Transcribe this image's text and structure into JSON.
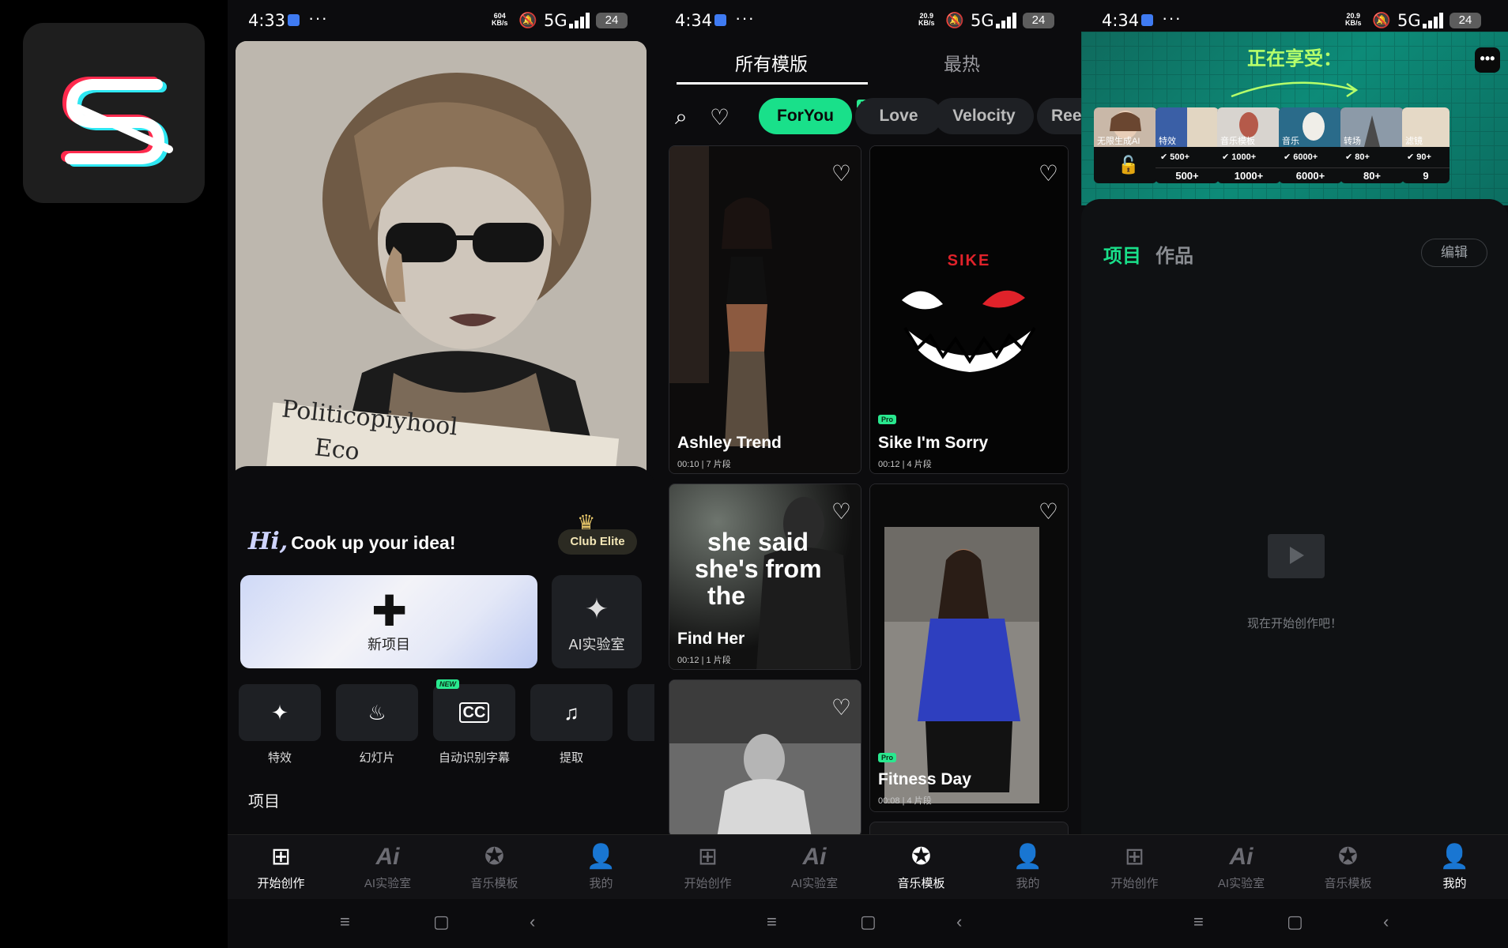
{
  "status_bars": [
    {
      "time": "4:33",
      "speed_top": "604",
      "speed_bottom": "KB/s",
      "network": "5G",
      "battery": "24"
    },
    {
      "time": "4:34",
      "speed_top": "20.9",
      "speed_bottom": "KB/s",
      "network": "5G",
      "battery": "24"
    },
    {
      "time": "4:34",
      "speed_top": "20.9",
      "speed_bottom": "KB/s",
      "network": "5G",
      "battery": "24"
    }
  ],
  "screen1": {
    "hero_text_1": "Politicopiyhool",
    "hero_text_2": "Eco",
    "greeting_hi": "Hi,",
    "greeting_text": "Cook up your idea!",
    "club_label": "Club Elite",
    "new_project_label": "新项目",
    "ai_lab_label": "AI实验室",
    "tools": [
      {
        "label": "特效",
        "icon": "sparkle-icon"
      },
      {
        "label": "幻灯片",
        "icon": "flame-icon"
      },
      {
        "label": "自动识别字幕",
        "icon": "cc-icon",
        "tag": "NEW"
      },
      {
        "label": "提取",
        "icon": "music-note-icon"
      }
    ],
    "projects_title": "项目"
  },
  "screen2": {
    "tabs": [
      "所有模版",
      "最热"
    ],
    "chips": [
      "ForYou",
      "Love",
      "Velocity",
      "Ree"
    ],
    "chip_new_tag": "NEW",
    "cards": [
      {
        "title": "Ashley Trend",
        "duration": "00:10",
        "clips": "7 片段"
      },
      {
        "title": "Sike I'm Sorry",
        "duration": "00:12",
        "clips": "4 片段",
        "tag": "Pro",
        "art_text": "SIKE"
      },
      {
        "title": "Find Her",
        "duration": "00:12",
        "clips": "1 片段",
        "overlay": [
          "she said",
          "she's from",
          "the"
        ]
      },
      {
        "title": "Fitness Day",
        "duration": "00:08",
        "clips": "4 片段",
        "tag": "Pro"
      },
      {
        "title": "",
        "duration": "",
        "clips": ""
      }
    ]
  },
  "screen3": {
    "enjoy_title": "正在享受：",
    "more_label": "•••",
    "features": [
      {
        "name": "无限生成AI",
        "badge": "",
        "count": ""
      },
      {
        "name": "特效",
        "badge": "500+",
        "count": "500+"
      },
      {
        "name": "音乐模板",
        "badge": "1000+",
        "count": "1000+"
      },
      {
        "name": "音乐",
        "badge": "6000+",
        "count": "6000+"
      },
      {
        "name": "转场",
        "badge": "80+",
        "count": "80+"
      },
      {
        "name": "滤镜",
        "badge": "90+",
        "count": "9"
      }
    ],
    "tabs": [
      "项目",
      "作品"
    ],
    "edit_label": "编辑",
    "empty_text": "现在开始创作吧！"
  },
  "bottom_nav": [
    "开始创作",
    "AI实验室",
    "音乐模板",
    "我的"
  ],
  "nav_active": [
    0,
    2,
    3
  ],
  "colors": {
    "accent_green": "#19e08a",
    "bg": "#0c0c0e",
    "banner_teal": "#0d8b78",
    "lime": "#b6ff6a"
  }
}
